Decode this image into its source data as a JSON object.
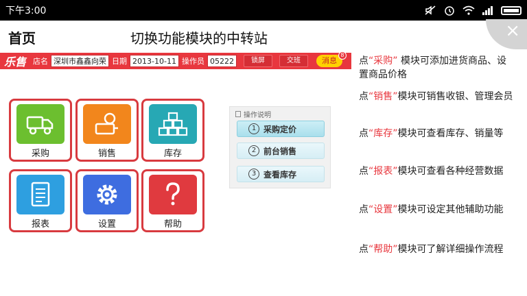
{
  "status_bar": {
    "time": "下午3:00"
  },
  "page": {
    "title": "首页",
    "guide_title": "切换功能模块的中转站",
    "close_symbol": "×"
  },
  "appbar": {
    "logo": "乐售",
    "store_label": "店名",
    "store_value": "深圳市鑫鑫向荣",
    "date_label": "日期",
    "date_value": "2013-10-11",
    "operator_label": "操作员",
    "operator_value": "05222",
    "lock_label": "锁屏",
    "shift_label": "交班",
    "message_label": "消息",
    "message_badge": "8"
  },
  "modules": [
    {
      "label": "采购",
      "icon": "truck-icon",
      "color": "#6cbf2f"
    },
    {
      "label": "销售",
      "icon": "sales-icon",
      "color": "#f2861c"
    },
    {
      "label": "库存",
      "icon": "boxes-icon",
      "color": "#27a8b4"
    },
    {
      "label": "报表",
      "icon": "report-icon",
      "color": "#2e9fe0"
    },
    {
      "label": "设置",
      "icon": "gear-icon",
      "color": "#3e6de0"
    },
    {
      "label": "帮助",
      "icon": "help-icon",
      "color": "#e03a3f"
    }
  ],
  "guide_panel": {
    "title": "操作说明",
    "steps": [
      {
        "num": "1",
        "label": "采购定价"
      },
      {
        "num": "2",
        "label": "前台销售"
      },
      {
        "num": "3",
        "label": "查看库存"
      }
    ]
  },
  "descriptions": [
    {
      "prefix": "点",
      "keyword": "“采购”",
      "text": "  模块可添加进货商品、设置商品价格"
    },
    {
      "prefix": "点",
      "keyword": "“销售”",
      "text": "模块可销售收银、管理会员"
    },
    {
      "prefix": "点",
      "keyword": "“库存”",
      "text": "模块可查看库存、销量等"
    },
    {
      "prefix": "点",
      "keyword": "“报表”",
      "text": "模块可查看各种经营数据"
    },
    {
      "prefix": "点",
      "keyword": "“设置”",
      "text": "模块可设定其他辅助功能"
    },
    {
      "prefix": "点",
      "keyword": "“帮助”",
      "text": "模块可了解详细操作流程"
    }
  ],
  "colors": {
    "accent": "#e8373e",
    "tile_border": "#d83a3f"
  }
}
